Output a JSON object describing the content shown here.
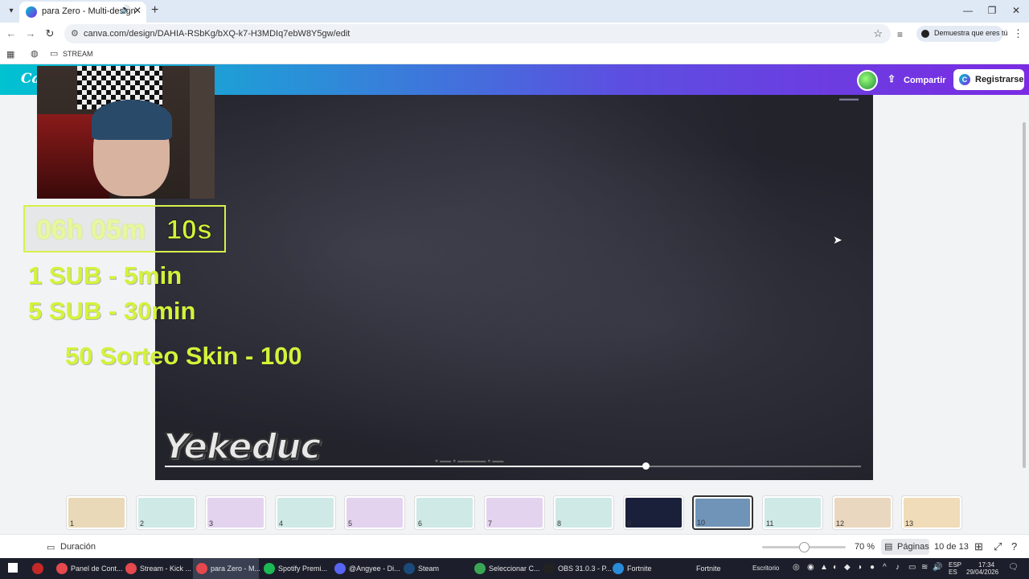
{
  "browser": {
    "tab_title": "para Zero - Multi-design",
    "url": "canva.com/design/DAHIA-RSbKg/bXQ-k7-H3MDIq7ebW8Y5gw/edit",
    "profile_label": "Demuestra que eres tú",
    "bookmark_folder": "STREAM"
  },
  "canva": {
    "logo": "Ca",
    "share_label": "Compartir",
    "register_label": "Registrarse"
  },
  "overlay": {
    "timer_dim": "06h 05m",
    "timer_bright": "10s",
    "line1": "1 SUB - 5min",
    "line2": "5 SUB - 30min",
    "line3": "50 Sorteo Skin - 100",
    "logo_text": "Yekeduc",
    "video_progress": 0.69
  },
  "pages": [
    {
      "num": "1",
      "color": "#e9d9b8"
    },
    {
      "num": "2",
      "color": "#cfe9e6"
    },
    {
      "num": "3",
      "color": "#e4d3ef"
    },
    {
      "num": "4",
      "color": "#cfe9e6"
    },
    {
      "num": "5",
      "color": "#e4d3ef"
    },
    {
      "num": "6",
      "color": "#cfe9e6"
    },
    {
      "num": "7",
      "color": "#e4d3ef"
    },
    {
      "num": "8",
      "color": "#cfe9e6"
    },
    {
      "num": "9",
      "color": "#1a1f3a"
    },
    {
      "num": "10",
      "color": "#6f94b8"
    },
    {
      "num": "11",
      "color": "#cfe9e6"
    },
    {
      "num": "12",
      "color": "#ead7bf"
    },
    {
      "num": "13",
      "color": "#f0dcb8"
    }
  ],
  "footer": {
    "duration_label": "Duración",
    "zoom_label": "70 %",
    "zoom_level": 0.5,
    "pages_label": "Páginas",
    "page_count": "10 de 13"
  },
  "taskbar": {
    "items": [
      {
        "label": "Panel de Cont...",
        "color": "#e5484d"
      },
      {
        "label": "Stream - Kick ...",
        "color": "#e5484d"
      },
      {
        "label": "para Zero - M...",
        "color": "#e5484d"
      },
      {
        "label": "Spotify Premi...",
        "color": "#1db954"
      },
      {
        "label": "@Angyee - Di...",
        "color": "#5865f2"
      },
      {
        "label": "Steam",
        "color": "#1b4a7a"
      },
      {
        "label": "Seleccionar C...",
        "color": "#3aa655"
      },
      {
        "label": "OBS 31.0.3 - P...",
        "color": "#222"
      },
      {
        "label": "Fortnite",
        "color": "#2a8bd8"
      },
      {
        "label": "Fortnite",
        "color": ""
      }
    ],
    "desktop_label": "Escritorio",
    "lang_top": "ESP",
    "lang_bottom": "ES",
    "time": "17:34",
    "date": "29/04/2026"
  }
}
